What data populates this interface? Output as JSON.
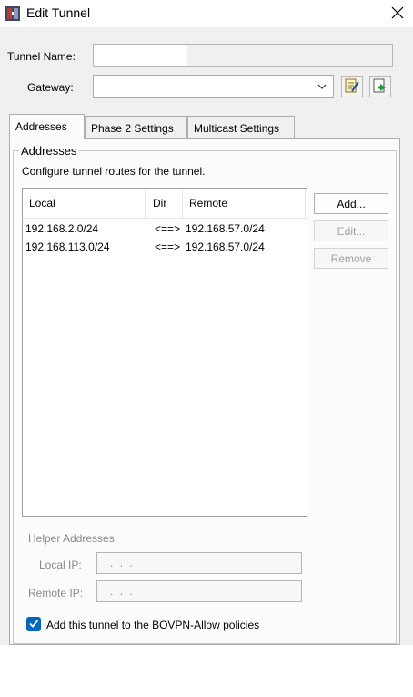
{
  "window": {
    "title": "Edit Tunnel"
  },
  "form": {
    "tunnel_name_label": "Tunnel Name:",
    "tunnel_name_value": "",
    "gateway_label": "Gateway:",
    "gateway_value": ""
  },
  "tabs": [
    {
      "label": "Addresses",
      "active": true
    },
    {
      "label": "Phase 2 Settings",
      "active": false
    },
    {
      "label": "Multicast Settings",
      "active": false
    }
  ],
  "addresses": {
    "group_title": "Addresses",
    "description": "Configure tunnel routes for the tunnel.",
    "columns": [
      "Local",
      "Dir",
      "Remote"
    ],
    "rows": [
      {
        "local": "192.168.2.0/24",
        "dir": "<==>",
        "remote": "192.168.57.0/24"
      },
      {
        "local": "192.168.113.0/24",
        "dir": "<==>",
        "remote": "192.168.57.0/24"
      }
    ],
    "buttons": {
      "add": "Add...",
      "edit": "Edit...",
      "remove": "Remove"
    }
  },
  "helper": {
    "title": "Helper Addresses",
    "local_ip_label": "Local IP:",
    "local_ip_value": ". . .",
    "remote_ip_label": "Remote IP:",
    "remote_ip_value": ". . ."
  },
  "policy_checkbox": {
    "label": "Add this tunnel to the BOVPN-Allow policies",
    "checked": true
  },
  "icons": {
    "app": "tunnel-app-icon",
    "close": "close-icon",
    "edit_gateway": "edit-gateway-icon",
    "add_gateway": "add-gateway-icon",
    "combo": "chevron-down-icon",
    "check": "checkmark-icon"
  },
  "colors": {
    "accent": "#0067c0",
    "panel": "#f0f0f0",
    "tab_page": "#fcfcfc"
  }
}
